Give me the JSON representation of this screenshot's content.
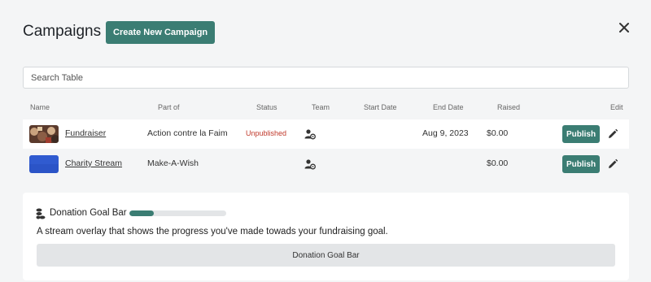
{
  "header": {
    "title": "Campaigns",
    "create_label": "Create New Campaign",
    "close_icon": "close-icon"
  },
  "search": {
    "placeholder": "Search Table",
    "value": ""
  },
  "table": {
    "columns": [
      "Name",
      "Part of",
      "Status",
      "Team",
      "Start Date",
      "End Date",
      "Raised",
      "Edit"
    ],
    "rows": [
      {
        "name": "Fundraiser",
        "part_of": "Action contre la Faim",
        "status": "Unpublished",
        "start_date": "",
        "end_date": "Aug 9, 2023",
        "raised": "$0.00",
        "action": "Publish",
        "thumbnail": "photo"
      },
      {
        "name": "Charity Stream",
        "part_of": "Make-A-Wish",
        "status": "",
        "start_date": "",
        "end_date": "",
        "raised": "$0.00",
        "action": "Publish",
        "thumbnail": "blue"
      }
    ]
  },
  "widget": {
    "title": "Donation Goal Bar",
    "progress": 0.25,
    "description": "A stream overlay that shows the progress you've made towads your fundraising goal.",
    "button_label": "Donation Goal Bar"
  },
  "colors": {
    "accent": "#3b7d73",
    "status_unpublished": "#c0392b",
    "background": "#f4f5f6"
  }
}
